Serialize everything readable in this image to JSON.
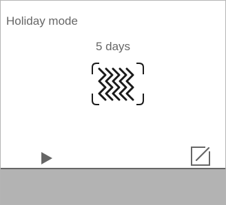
{
  "screen": {
    "title": "Holiday mode",
    "duration_value": "5 days"
  },
  "icons": {
    "mode": "heating-waves-icon",
    "play": "play-icon",
    "edit": "edit-icon"
  },
  "colors": {
    "text": "#666666",
    "icon_dark": "#1a1a1a",
    "bottom_bar": "#b3b3b3"
  }
}
